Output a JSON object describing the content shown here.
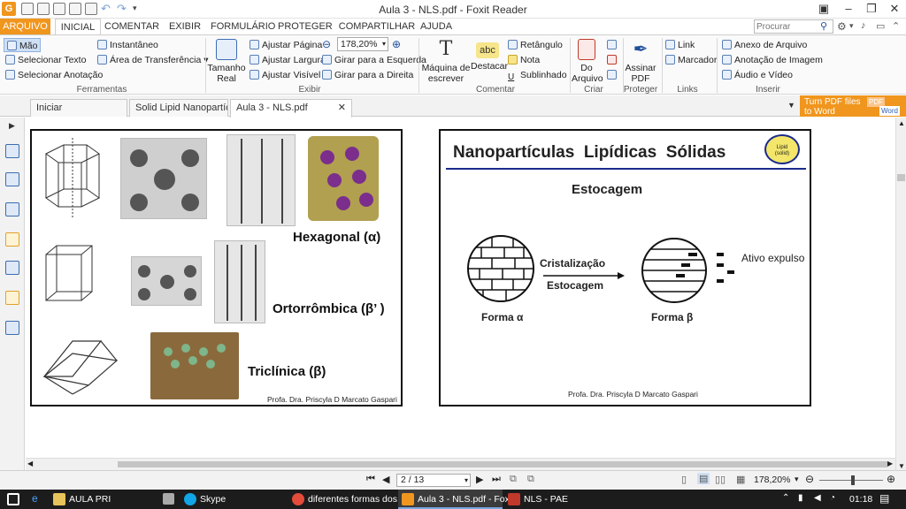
{
  "window": {
    "title": "Aula 3 - NLS.pdf - Foxit Reader"
  },
  "menu": {
    "tabs": [
      "ARQUIVO",
      "INICIAL",
      "COMENTAR",
      "EXIBIR",
      "FORMULÁRIO",
      "PROTEGER",
      "COMPARTILHAR",
      "AJUDA"
    ]
  },
  "search": {
    "placeholder": "Procurar"
  },
  "ribbon": {
    "ferramentas": {
      "items": [
        "Mão",
        "Selecionar Texto",
        "Selecionar Anotação"
      ],
      "label": "Ferramentas"
    },
    "clip": {
      "items": [
        "Instantâneo",
        "Área de Transferência"
      ]
    },
    "exibir": {
      "tamanho_l1": "Tamanho",
      "tamanho_l2": "Real",
      "ajustar_pagina": "Ajustar Página",
      "ajustar_largura": "Ajustar Largura",
      "ajustar_visivel": "Ajustar Visível",
      "zoom": "178,20%",
      "girar_esq": "Girar para a Esquerda",
      "girar_dir": "Girar para a Direita",
      "label": "Exibir"
    },
    "comentar": {
      "maquina_l1": "Máquina de",
      "maquina_l2": "escrever",
      "destacar": "Destacar",
      "abc": "abc",
      "retangulo": "Retângulo",
      "nota": "Nota",
      "sublinhado": "Sublinhado",
      "label": "Comentar"
    },
    "criar": {
      "do_l1": "Do",
      "do_l2": "Arquivo",
      "label": "Criar"
    },
    "proteger": {
      "assinar_l1": "Assinar",
      "assinar_l2": "PDF",
      "label": "Proteger"
    },
    "links": {
      "link": "Link",
      "marcador": "Marcador",
      "label": "Links"
    },
    "inserir": {
      "anexo": "Anexo de Arquivo",
      "anotacao": "Anotação de Imagem",
      "audio": "Áudio e Vídeo",
      "label": "Inserir"
    }
  },
  "doc_tabs": [
    "Iniciar",
    "Solid Lipid Nanopartícl...",
    "Aula 3 - NLS.pdf"
  ],
  "promo": {
    "line1": "Turn PDF files",
    "line2": "to Word",
    "badge1": "PDF",
    "badge2": "Word"
  },
  "slide_left": {
    "hexagonal": "Hexagonal (α)",
    "ortorrombica": "Ortorrômbica (β’ )",
    "triclinica": "Triclínica (β)",
    "credit": "Profa. Dra. Priscyla D Marcato Gaspari"
  },
  "slide_right": {
    "title": "Nanopartículas  Lipídicas  Sólidas",
    "logo_l1": "Lipid",
    "logo_l2": "(solid)",
    "subtitle": "Estocagem",
    "cristalizacao": "Cristalização",
    "estocagem": "Estocagem",
    "forma_alpha": "Forma α",
    "forma_beta": "Forma β",
    "ativo": "Ativo expulso",
    "credit": "Profa. Dra. Priscyla D Marcato Gaspari"
  },
  "status": {
    "page": "2 / 13",
    "zoom": "178,20%"
  },
  "taskbar": {
    "items": [
      "AULA PRI",
      "Skype",
      "diferentes formas dos...",
      "Aula 3 - NLS.pdf - Fox...",
      "NLS - PAE"
    ],
    "time": "01:18"
  },
  "colors": {
    "accent": "#f0961e",
    "slide_rule": "#1a2b8c"
  }
}
